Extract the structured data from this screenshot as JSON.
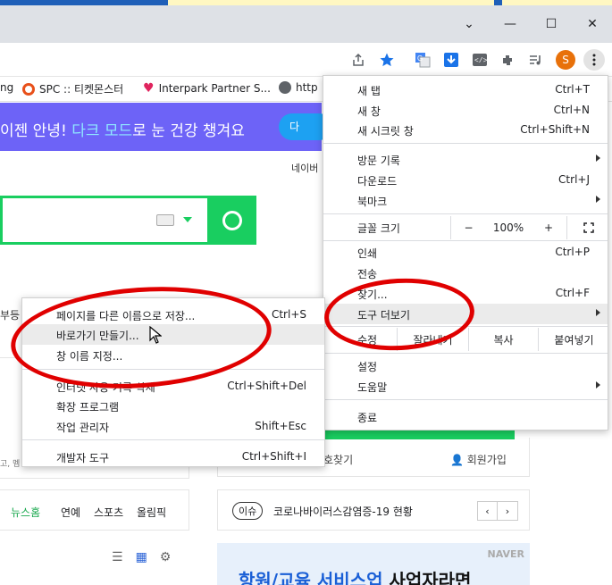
{
  "window": {
    "minimize": "—",
    "maximize": "☐",
    "close": "✕",
    "tabs_chevron": "⌄"
  },
  "toolbar": {
    "icons": [
      "share-icon",
      "star-icon",
      "translate-icon",
      "download-icon",
      "devtools-icon",
      "extensions-icon",
      "media-icon",
      "more-icon"
    ],
    "avatar_letter": "S"
  },
  "bookmarks": [
    {
      "label": "ng"
    },
    {
      "label": "SPC :: 티켓몬스터"
    },
    {
      "label": "Interpark Partner S..."
    },
    {
      "label": "http"
    }
  ],
  "page": {
    "banner_pre": "이젠 안녕! ",
    "banner_accent": "다크 모드",
    "banner_post": "로 눈 건강 챙겨요",
    "twitter_label": "다",
    "naver_top": "네이버",
    "bu_label": "부등",
    "small_text": "고, 멤",
    "news": [
      "뉴스홈",
      "연예",
      "스포츠",
      "올림픽"
    ],
    "login_links": [
      "호찾기",
      "회원가입"
    ],
    "issue_pill": "이슈",
    "issue_text": "코로나바이러스감염증-19 현황",
    "ad_tag": "NAVER",
    "ad_text_accent": "항원/교육 서비스업",
    "ad_text_dark": "사업자라면"
  },
  "main_menu": {
    "new_tab": "새 탭",
    "new_tab_sc": "Ctrl+T",
    "new_window": "새 창",
    "new_window_sc": "Ctrl+N",
    "incognito": "새 시크릿 창",
    "incognito_sc": "Ctrl+Shift+N",
    "history": "방문 기록",
    "downloads": "다운로드",
    "downloads_sc": "Ctrl+J",
    "bookmarks": "북마크",
    "zoom_label": "글꼴 크기",
    "zoom_minus": "−",
    "zoom_value": "100%",
    "zoom_plus": "+",
    "print": "인쇄",
    "print_sc": "Ctrl+P",
    "cast": "전송",
    "find": "찾기...",
    "find_sc": "Ctrl+F",
    "more_tools": "도구 더보기",
    "edit_label": "수정",
    "cut": "잘라내기",
    "copy": "복사",
    "paste": "붙여넣기",
    "settings": "설정",
    "help": "도움말",
    "exit": "종료"
  },
  "sub_menu": {
    "save_page": "페이지를 다른 이름으로 저장...",
    "save_page_sc": "Ctrl+S",
    "create_shortcut": "바로가기 만들기...",
    "name_window": "창 이름 지정...",
    "clear_data": "인터넷 사용 기록 삭제",
    "clear_data_sc": "Ctrl+Shift+Del",
    "extensions": "확장 프로그램",
    "task_manager": "작업 관리자",
    "task_manager_sc": "Shift+Esc",
    "dev_tools": "개발자 도구",
    "dev_tools_sc": "Ctrl+Shift+I"
  },
  "colors": {
    "naver_green": "#19ce60",
    "annotation_red": "#e00000",
    "banner_purple": "#6d63f7"
  }
}
